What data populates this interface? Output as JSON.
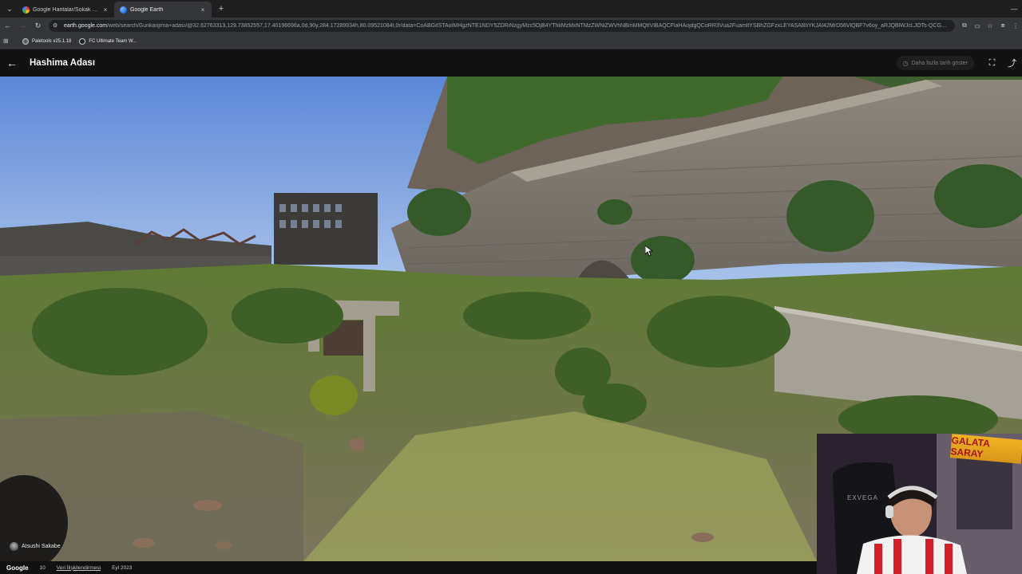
{
  "browser": {
    "tabs": [
      {
        "title": "Google Haritalar/Sokak Görün",
        "active": false,
        "icon": "google-maps-favicon"
      },
      {
        "title": "Google Earth",
        "active": true,
        "icon": "google-earth-favicon"
      }
    ],
    "new_tab_symbol": "+",
    "tab_close_symbol": "×",
    "url_host": "earth.google.com",
    "url_rest": "/web/search/Gunkanjima+adası/@32.62763313,129.73852557,17.40196696a,0d,90y,284.17289934h,80.09521084t,0r/data=CoABGiISTAoIMHgzNTE1NDY5ZDRiNzgyMzc5OjB4YThkMzMxNTMzZWNiZWVhNBmMMQtIVlBAQCFlaHAojdgQCoRR3Vua2FuamltYSBhZGFzxLEYASABIiYKJAl42MrD56VlQBF7v6oy_aRJQBlWJcLJOTs-QCGDC...",
    "bookmarks": [
      {
        "label": "Paletools v25.1.18"
      },
      {
        "label": "FC Ultimate Team W..."
      }
    ]
  },
  "header": {
    "title": "Hashima Adası",
    "history_label": "Daha fazla tarih göster"
  },
  "footer": {
    "logo": "Google",
    "status_number": "10",
    "data_link": "Veri İlişkilendirmesi",
    "date": "Eyl 2023"
  },
  "scene": {
    "photographer": "Atsushi Sakabe"
  },
  "webcam": {
    "sign_text": "GALATA SARAY",
    "chair_brand": "EXVEGA"
  },
  "colors": {
    "sky": "#6f9be0",
    "grass": "#7b9140",
    "concrete": "#9a968d",
    "header_bg": "#121212"
  }
}
